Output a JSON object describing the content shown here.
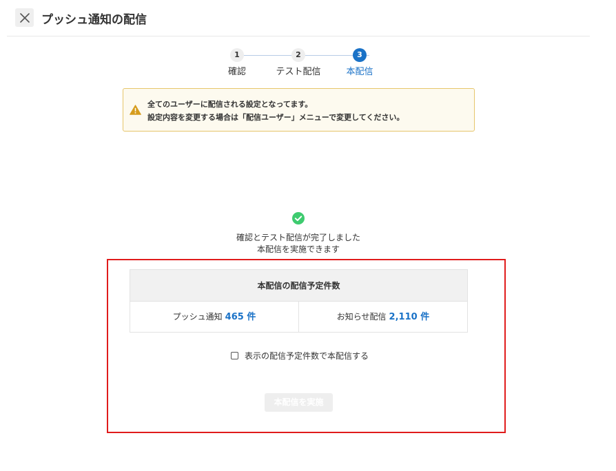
{
  "header": {
    "title": "プッシュ通知の配信"
  },
  "stepper": {
    "steps": [
      {
        "number": "1",
        "label": "確認"
      },
      {
        "number": "2",
        "label": "テスト配信"
      },
      {
        "number": "3",
        "label": "本配信"
      }
    ],
    "current_step": 3
  },
  "alert": {
    "line1": "全てのユーザーに配信される設定となってます。",
    "line2": "設定内容を変更する場合は「配信ユーザー」メニューで変更してください。"
  },
  "status": {
    "line1": "確認とテスト配信が完了しました",
    "line2": "本配信を実施できます"
  },
  "count_table": {
    "heading": "本配信の配信予定件数",
    "push": {
      "label": "プッシュ通知",
      "value": "465 件"
    },
    "notice": {
      "label": "お知らせ配信",
      "value": "2,110 件"
    }
  },
  "confirm": {
    "label": "表示の配信予定件数で本配信する",
    "checked": false
  },
  "submit": {
    "label": "本配信を実施"
  },
  "colors": {
    "accent": "#1a72c7",
    "success": "#3ecb6f",
    "warning": "#d69c1d",
    "highlight_frame": "#e01b1b"
  }
}
